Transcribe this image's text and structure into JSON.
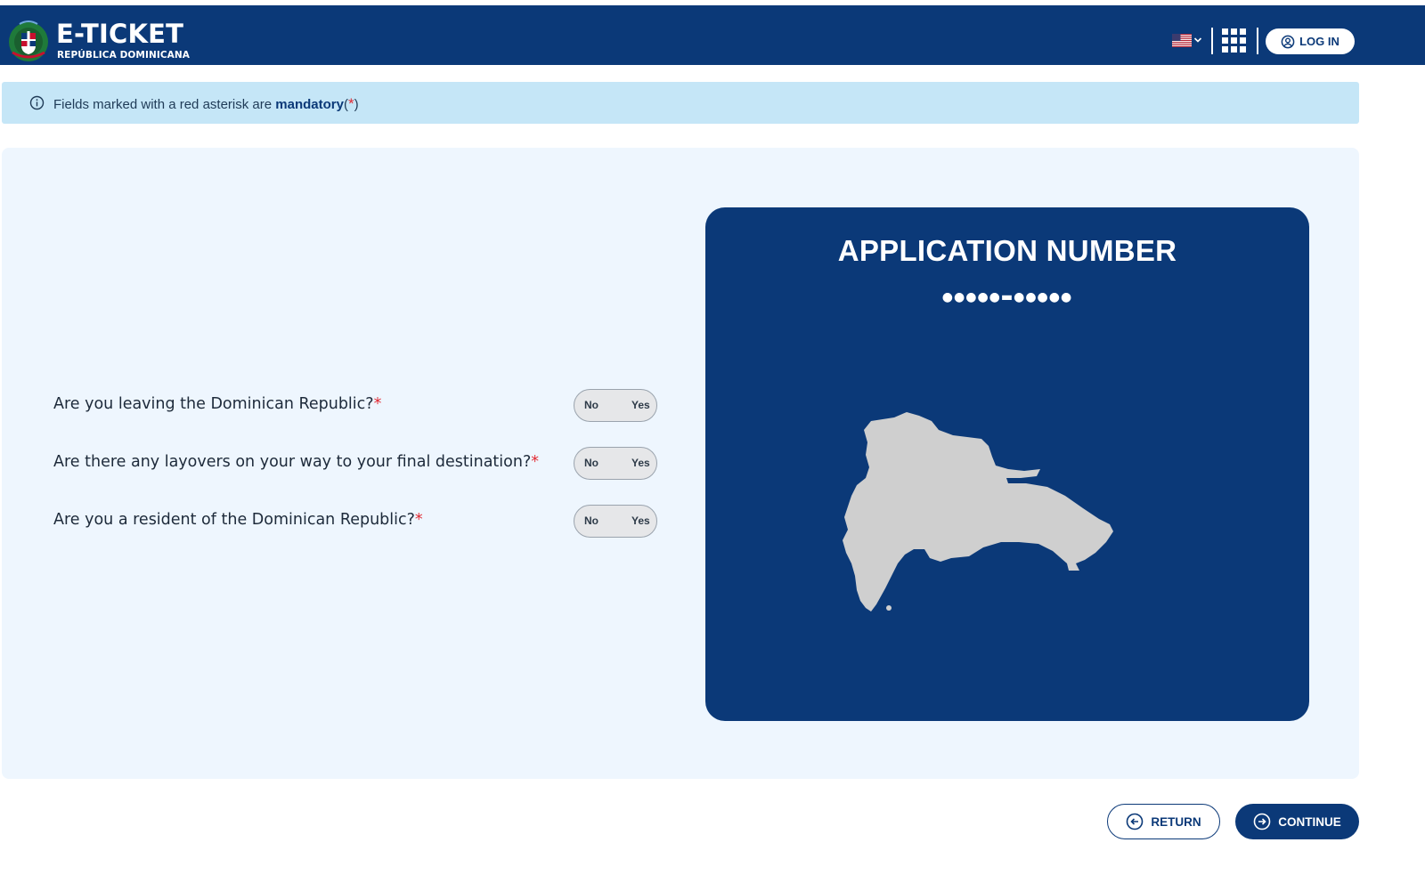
{
  "header": {
    "logo_title": "E-TICKET",
    "logo_subtitle": "REPÚBLICA DOMINICANA",
    "language_icon": "us-flag-icon",
    "apps_icon": "apps-grid-icon",
    "login_label": "LOG IN",
    "login_icon": "user-circle-icon"
  },
  "notice": {
    "icon": "info-icon",
    "text_before": "Fields marked with a red asterisk are ",
    "text_bold": "mandatory",
    "text_open": "(",
    "asterisk": "*",
    "text_close": ")"
  },
  "questions": [
    {
      "label": "Are you leaving the Dominican Republic?",
      "required_mark": "*",
      "option_no": "No",
      "option_yes": "Yes"
    },
    {
      "label": "Are there any layovers on your way to your final destination?",
      "required_mark": "*",
      "option_no": "No",
      "option_yes": "Yes"
    },
    {
      "label": "Are you a resident of the Dominican Republic?",
      "required_mark": "*",
      "option_no": "No",
      "option_yes": "Yes"
    }
  ],
  "application": {
    "title": "APPLICATION NUMBER",
    "masked_number": "●●●●●▬●●●●●",
    "map_icon": "dominican-republic-map"
  },
  "footer": {
    "return_label": "RETURN",
    "return_icon": "arrow-left-circle-icon",
    "continue_label": "CONTINUE",
    "continue_icon": "arrow-right-circle-icon"
  },
  "colors": {
    "primary": "#0b3978",
    "notice_bg": "#c5e6f7",
    "panel_bg": "#eef6fe",
    "required": "#e22b34",
    "map_fill": "#cfcfcf"
  }
}
